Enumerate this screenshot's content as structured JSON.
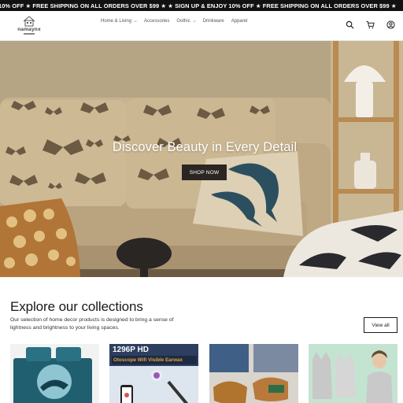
{
  "announcement": {
    "text": "10% OFF ★ FREE SHIPPING ON ALL ORDERS OVER $99 ★   ★ SIGN UP & ENJOY 10% OFF ★ FREE SHIPPING ON ALL ORDERS OVER $99 ★"
  },
  "header": {
    "logo_text": "namaynx",
    "nav": [
      {
        "label": "Home & Living",
        "has_dropdown": true
      },
      {
        "label": "Accessories",
        "has_dropdown": false
      },
      {
        "label": "Gothic",
        "has_dropdown": true
      },
      {
        "label": "Drinkware",
        "has_dropdown": false
      },
      {
        "label": "Apparel",
        "has_dropdown": false
      }
    ],
    "icons": [
      "search-icon",
      "cart-icon",
      "account-icon"
    ]
  },
  "hero": {
    "title": "Discover Beauty in Every Detail",
    "button_label": "SHOP NOW"
  },
  "collections": {
    "title": "Explore our collections",
    "description": "Our selection of home decor products is designed to bring a sense of lightness and brightness to your living spaces.",
    "view_all_label": "View all",
    "cards": [
      {
        "name": "dolphin-bedding"
      },
      {
        "name": "otoscope",
        "title": "1296P HD",
        "subtitle": "Otoscope Wifi Visible Earwax"
      },
      {
        "name": "sandals"
      },
      {
        "name": "tank-tops"
      }
    ]
  },
  "colors": {
    "announcement_bg": "#111111",
    "button_bg": "#2b2622",
    "hero_wall": "#b9a787"
  }
}
